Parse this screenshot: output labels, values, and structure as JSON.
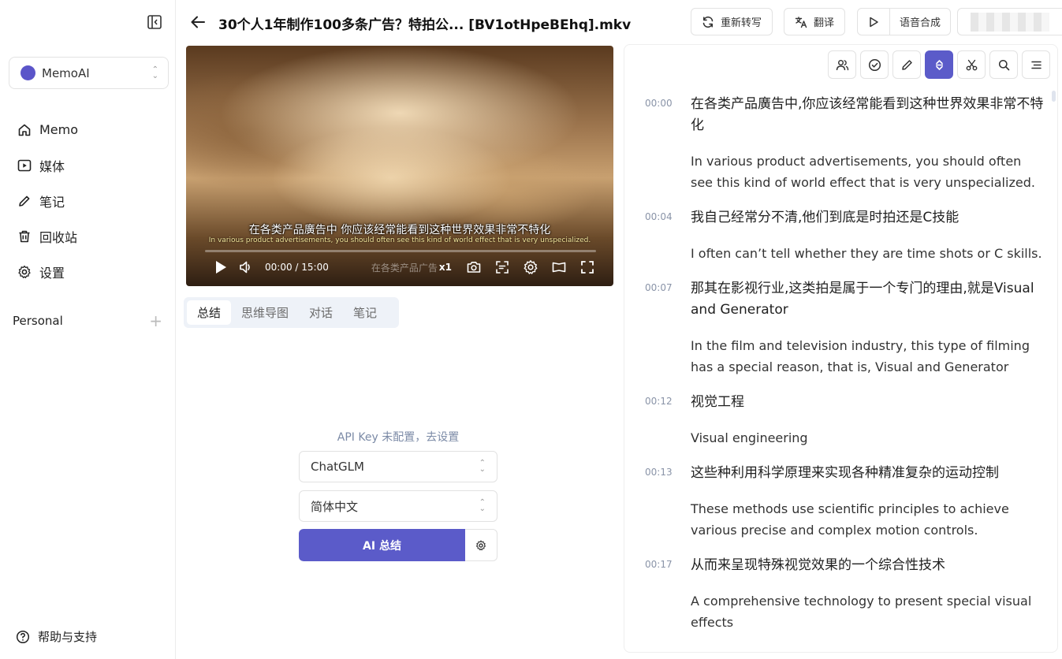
{
  "sidebar": {
    "workspace": "MemoAI",
    "nav": [
      {
        "label": "Memo",
        "icon": "home-icon"
      },
      {
        "label": "媒体",
        "icon": "play-square-icon"
      },
      {
        "label": "笔记",
        "icon": "pencil-icon"
      },
      {
        "label": "回收站",
        "icon": "trash-icon"
      },
      {
        "label": "设置",
        "icon": "gear-icon"
      }
    ],
    "personal_label": "Personal",
    "personal_add": "+",
    "help_label": "帮助与支持"
  },
  "header": {
    "title": "30个人1年制作100多条广告？特拍公... [BV1otHpeBEhq].mkv",
    "retranscribe_label": "重新转写",
    "translate_label": "翻译",
    "tts_label": "语音合成"
  },
  "video": {
    "subtitle_cn": "在各类产品廣告中 你应该经常能看到这种世界效果非常不特化",
    "subtitle_en": "In various product advertisements, you should often see this kind of world effect that is very unspecialized.",
    "time": "00:00 / 15:00",
    "ghost_subtitle": "在各类产品广告",
    "speed": "x1",
    "progress": 0
  },
  "tabs": [
    "总结",
    "思维导图",
    "对话",
    "笔记"
  ],
  "active_tab": 0,
  "summary": {
    "api_note": "API Key 未配置，",
    "api_link": "去设置",
    "model": "ChatGLM",
    "language": "简体中文",
    "ai_button": "AI 总结"
  },
  "transcript_tools": [
    "speakers-icon",
    "check-circle-icon",
    "pencil-icon",
    "sort-icon",
    "scissors-icon",
    "search-icon",
    "menu-icon"
  ],
  "segments": [
    {
      "time": "00:00",
      "cn": "在各类产品廣告中,你应该经常能看到这种世界效果非常不特化",
      "en": "In various product advertisements, you should often see this kind of world effect that is very unspecialized."
    },
    {
      "time": "00:04",
      "cn": "我自己经常分不清,他们到底是时拍还是C技能",
      "en": "I often can’t tell whether they are time shots or C skills."
    },
    {
      "time": "00:07",
      "cn": "那其在影视行业,这类拍是属于一个专门的理由,就是Visual and Generator",
      "en": "In the film and television industry, this type of filming has a special reason, that is, Visual and Generator"
    },
    {
      "time": "00:12",
      "cn": "视觉工程",
      "en": "Visual engineering"
    },
    {
      "time": "00:13",
      "cn": "这些种利用科学原理来实现各种精准复杂的运动控制",
      "en": "These methods use scientific principles to achieve various precise and complex motion controls."
    },
    {
      "time": "00:17",
      "cn": "从而来呈现特殊视觉效果的一个综合性技术",
      "en": "A comprehensive technology to present special visual effects"
    }
  ]
}
